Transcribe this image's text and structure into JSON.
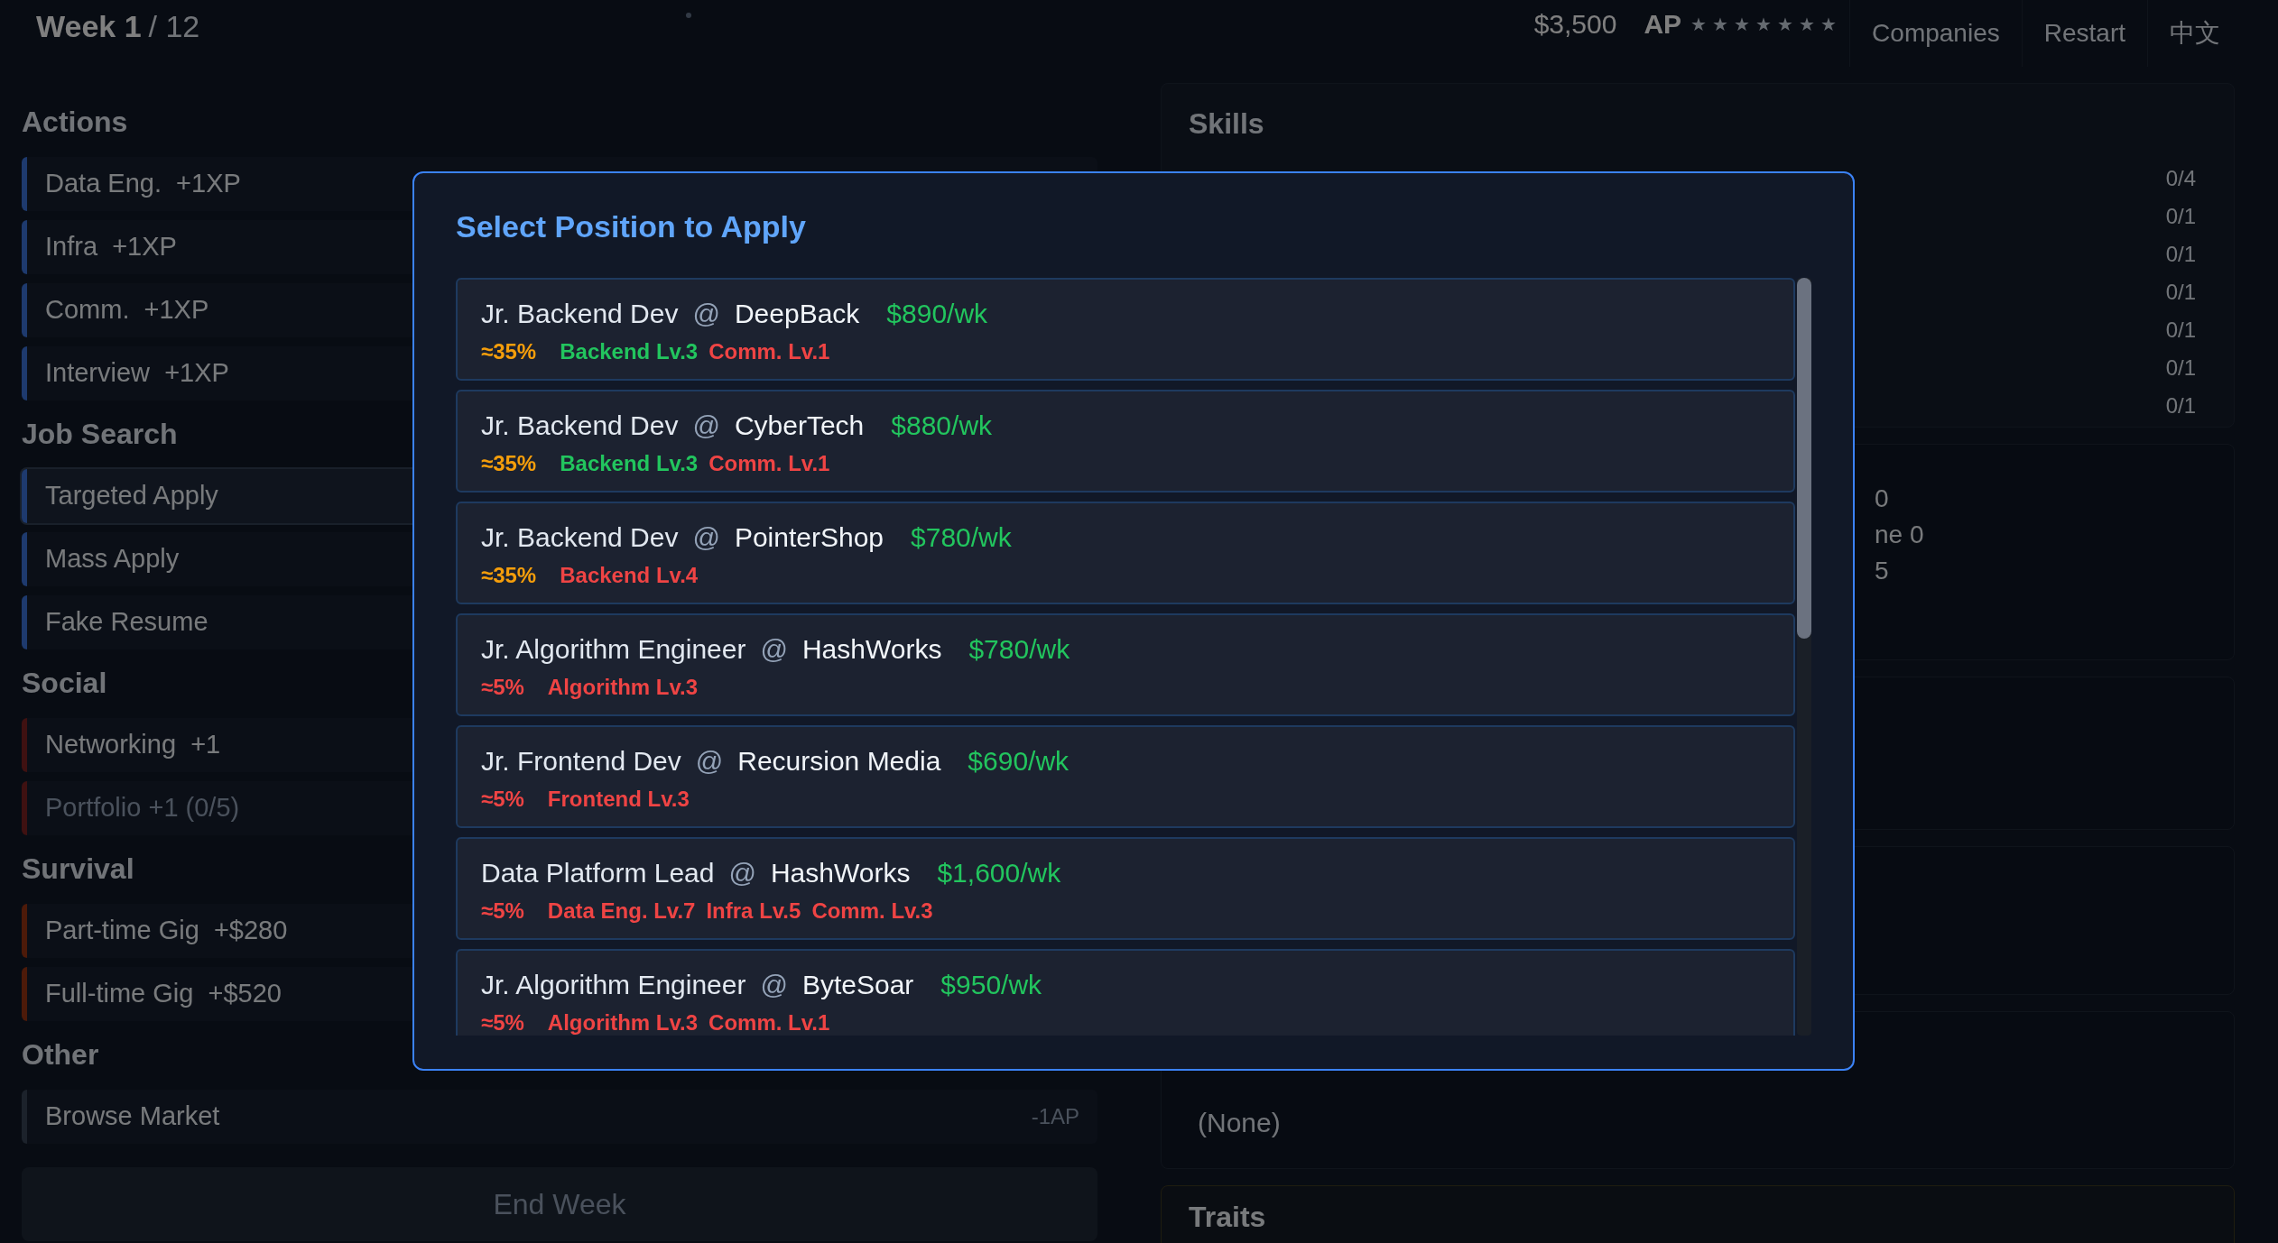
{
  "top_bar": {
    "week": "Week 1",
    "week_total": "/ 12",
    "money": "$3,500",
    "ap_label": "AP",
    "ap": {
      "stars": 7,
      "glyph": "★"
    },
    "buttons": [
      "Companies",
      "Restart",
      "中文"
    ]
  },
  "actions": {
    "sections": [
      {
        "title": "Actions",
        "color": "#1e3a6e",
        "items": [
          {
            "label": "Data Eng.  +1XP",
            "selected": false,
            "disabled": false
          },
          {
            "label": "Infra  +1XP",
            "selected": false,
            "disabled": false
          },
          {
            "label": "Comm.  +1XP",
            "selected": false,
            "disabled": false
          },
          {
            "label": "Interview  +1XP",
            "selected": false,
            "disabled": false
          }
        ]
      },
      {
        "title": "Job Search",
        "color": "#1e3a6e",
        "items": [
          {
            "label": "Targeted Apply",
            "selected": true,
            "disabled": false
          },
          {
            "label": "Mass Apply",
            "selected": false,
            "disabled": false
          },
          {
            "label": "Fake Resume",
            "selected": false,
            "disabled": false
          }
        ]
      },
      {
        "title": "Social",
        "color": "#3f1111",
        "items": [
          {
            "label": "Networking  +1",
            "selected": false,
            "disabled": false
          },
          {
            "label": "Portfolio +1 (0/5)",
            "selected": false,
            "disabled": true
          }
        ]
      },
      {
        "title": "Survival",
        "color": "#4d1a09",
        "items": [
          {
            "label": "Part-time Gig  +$280",
            "selected": false,
            "disabled": false
          },
          {
            "label": "Full-time Gig  +$520",
            "selected": false,
            "disabled": false
          }
        ]
      },
      {
        "title": "Other",
        "color": "#1c222b",
        "items": [
          {
            "label": "Browse Market",
            "cost": "-1AP",
            "selected": false,
            "disabled": false
          }
        ]
      }
    ],
    "end_button": "End Week"
  },
  "side": {
    "skills_title": "Skills",
    "skill_counts": [
      "0/4",
      "0/1",
      "0/1",
      "0/1",
      "0/1",
      "0/1",
      "0/1"
    ],
    "stats": [
      "0",
      "ne 0",
      "5"
    ],
    "empty_text": "(None)",
    "traits_title": "Traits"
  },
  "modal": {
    "title": "Select Position to Apply",
    "positions": [
      {
        "role": "Jr. Backend Dev",
        "at": "@",
        "company": "DeepBack",
        "pay": "$890/wk",
        "chance": {
          "text": "≈35%",
          "color": "#f59e0b"
        },
        "requirements": [
          {
            "text": "Backend Lv.3",
            "met": true
          },
          {
            "text": "Comm. Lv.1",
            "met": false
          }
        ]
      },
      {
        "role": "Jr. Backend Dev",
        "at": "@",
        "company": "CyberTech",
        "pay": "$880/wk",
        "chance": {
          "text": "≈35%",
          "color": "#f59e0b"
        },
        "requirements": [
          {
            "text": "Backend Lv.3",
            "met": true
          },
          {
            "text": "Comm. Lv.1",
            "met": false
          }
        ]
      },
      {
        "role": "Jr. Backend Dev",
        "at": "@",
        "company": "PointerShop",
        "pay": "$780/wk",
        "chance": {
          "text": "≈35%",
          "color": "#f59e0b"
        },
        "requirements": [
          {
            "text": "Backend Lv.4",
            "met": false
          }
        ]
      },
      {
        "role": "Jr. Algorithm Engineer",
        "at": "@",
        "company": "HashWorks",
        "pay": "$780/wk",
        "chance": {
          "text": "≈5%",
          "color": "#ef4444"
        },
        "requirements": [
          {
            "text": "Algorithm Lv.3",
            "met": false
          }
        ]
      },
      {
        "role": "Jr. Frontend Dev",
        "at": "@",
        "company": "Recursion Media",
        "pay": "$690/wk",
        "chance": {
          "text": "≈5%",
          "color": "#ef4444"
        },
        "requirements": [
          {
            "text": "Frontend Lv.3",
            "met": false
          }
        ]
      },
      {
        "role": "Data Platform Lead",
        "at": "@",
        "company": "HashWorks",
        "pay": "$1,600/wk",
        "chance": {
          "text": "≈5%",
          "color": "#ef4444"
        },
        "requirements": [
          {
            "text": "Data Eng. Lv.7",
            "met": false
          },
          {
            "text": "Infra Lv.5",
            "met": false
          },
          {
            "text": "Comm. Lv.3",
            "met": false
          }
        ]
      },
      {
        "role": "Jr. Algorithm Engineer",
        "at": "@",
        "company": "ByteSoar",
        "pay": "$950/wk",
        "chance": {
          "text": "≈5%",
          "color": "#ef4444"
        },
        "requirements": [
          {
            "text": "Algorithm Lv.3",
            "met": false
          },
          {
            "text": "Comm. Lv.1",
            "met": false
          }
        ]
      }
    ]
  }
}
